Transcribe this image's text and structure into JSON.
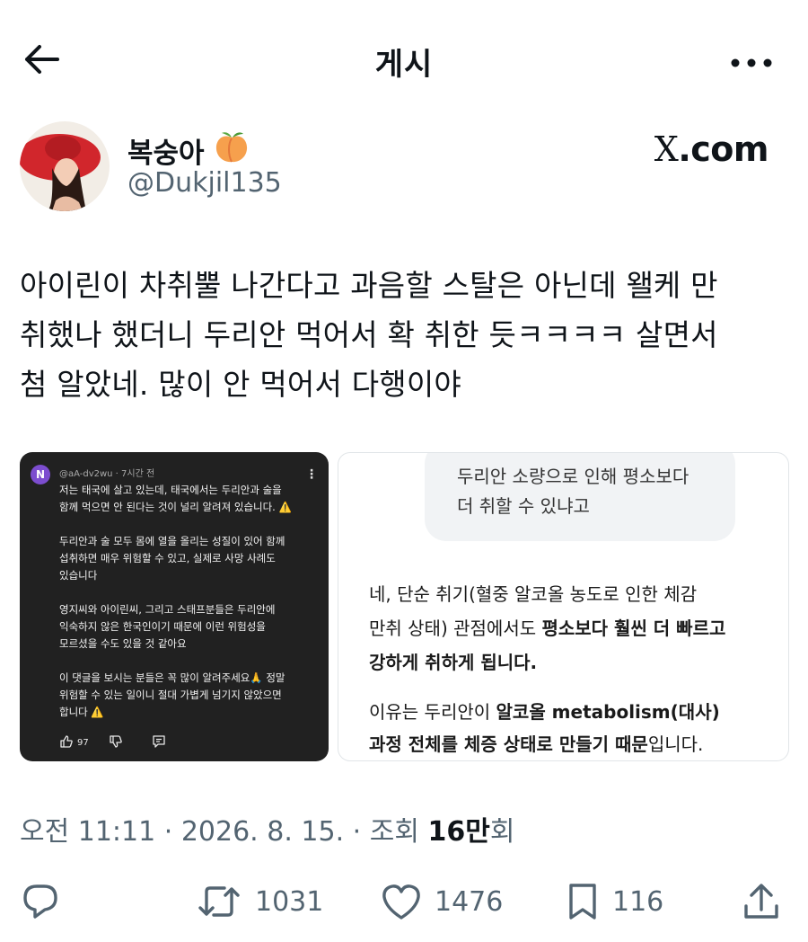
{
  "header": {
    "title": "게시",
    "back_icon": "arrow-left-icon",
    "more_icon": "more-horizontal-icon"
  },
  "author": {
    "display_name": "복숭아",
    "emoji": "🍑",
    "handle": "@Dukjil135",
    "source": ".com",
    "source_mark": "X"
  },
  "tweet": {
    "lines": [
      "아이린이 차취뿔 나간다고 과음할 스탈은 아닌데 왤케 만",
      "취했나 했더니 두리안 먹어서 확 취한 듯ㅋㅋㅋㅋ 살면서",
      "첨 알았네. 많이 안 먹어서 다행이야"
    ]
  },
  "media_left": {
    "avatar_letter": "N",
    "meta": "@aA-dv2wu · 7시간 전",
    "paragraphs": [
      "저는 태국에 살고 있는데, 태국에서는 두리안과 술을\n함께 먹으면 안 된다는 것이 널리 알려져 있습니다. ⚠️",
      "두리안과 술 모두 몸에 열을 올리는 성질이 있어 함께\n섭취하면 매우 위험할 수 있고, 실제로 사망 사례도\n있습니다",
      "영지씨와 아이린씨, 그리고 스태프분들은 두리안에\n익숙하지 않은 한국인이기 때문에 이런 위험성을\n모르셨을 수도 있을 것 같아요",
      "이 댓글을 보시는 분들은 꼭 많이 알려주세요🙏 정말\n위험할 수 있는 일이니 절대 가볍게 넘기지 않았으면\n합니다 ⚠️"
    ],
    "like_count": "97"
  },
  "media_right": {
    "bubble_lines": [
      "두리안 소량으로 인해 평소보다",
      "더 취할 수 있냐고"
    ],
    "answer_plain_1": "네, 단순 취기(혈중 알코올 농도로 인한 체감",
    "answer_plain_2": "만취 상태) 관점에서도 ",
    "answer_bold_1": "평소보다 훨씬 더 빠르고",
    "answer_bold_2": "강하게 취하게 됩니다.",
    "reason_plain_1": "이유는 두리안이 ",
    "reason_bold_1": "알코올 metabolism(대사)",
    "reason_bold_2": "과정 전체를 체증 상태로 만들기 때문",
    "reason_plain_2": "입니다."
  },
  "meta": {
    "time": "오전 11:11",
    "sep1": " · ",
    "date": "2026. 8. 15.",
    "sep2": " · 조회 ",
    "views_count": "16만",
    "views_suffix": "회"
  },
  "actions": {
    "reply_icon": "reply-icon",
    "retweet_icon": "retweet-icon",
    "retweet_count": "1031",
    "like_icon": "heart-icon",
    "like_count": "1476",
    "bookmark_icon": "bookmark-icon",
    "bookmark_count": "116",
    "share_icon": "share-icon"
  },
  "colors": {
    "text": "#0f1419",
    "secondary": "#536471",
    "comment_bg": "#212121",
    "bubble_bg": "#f1f3f5"
  }
}
